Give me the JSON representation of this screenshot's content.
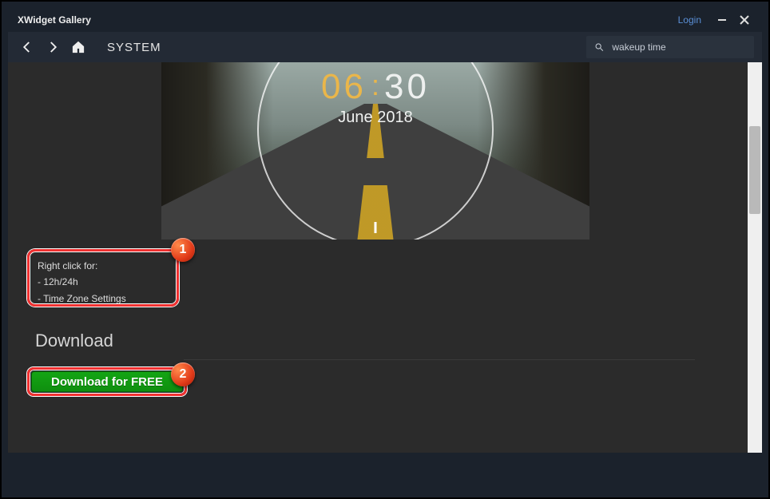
{
  "window": {
    "title": "XWidget Gallery",
    "login_label": "Login"
  },
  "toolbar": {
    "breadcrumb": "SYSTEM",
    "search_placeholder": "",
    "search_value": "wakeup time"
  },
  "preview": {
    "clock_hh": "06",
    "clock_colon": ":",
    "clock_mm": "30",
    "month_label": "June 2018"
  },
  "description": {
    "line1": "Right click for:",
    "line2": "- 12h/24h",
    "line3": "- Time Zone Settings"
  },
  "download": {
    "heading": "Download",
    "button_label": "Download for FREE"
  },
  "annotations": {
    "badge1": "1",
    "badge2": "2"
  }
}
